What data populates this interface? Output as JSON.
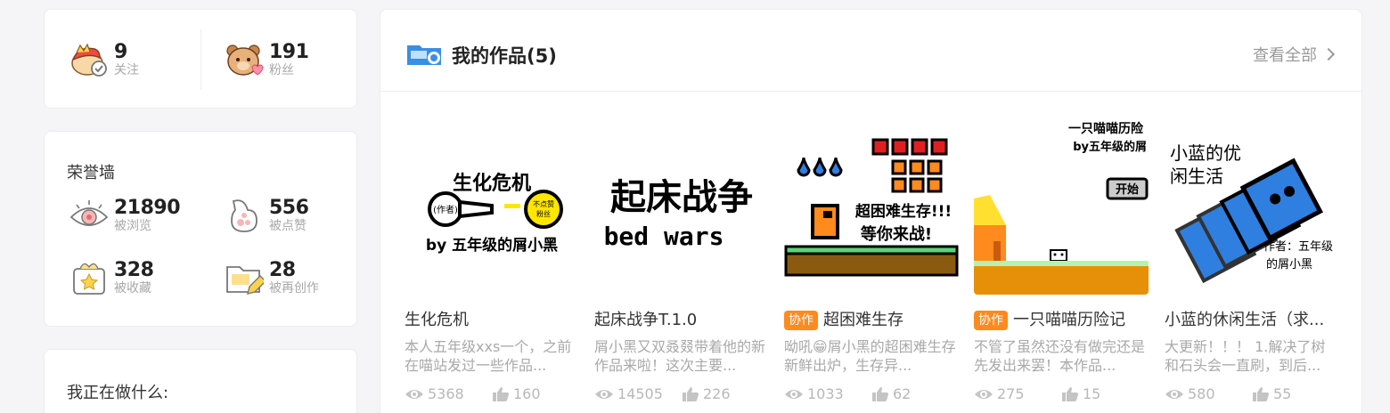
{
  "follow": {
    "following": {
      "count": "9",
      "label": "关注"
    },
    "fans": {
      "count": "191",
      "label": "粉丝"
    }
  },
  "honor": {
    "title": "荣誉墙",
    "items": [
      {
        "count": "21890",
        "label": "被浏览"
      },
      {
        "count": "556",
        "label": "被点赞"
      },
      {
        "count": "328",
        "label": "被收藏"
      },
      {
        "count": "28",
        "label": "被再创作"
      }
    ]
  },
  "doing": {
    "title": "我正在做什么:"
  },
  "works": {
    "title": "我的作品(5)",
    "view_all": "查看全部",
    "items": [
      {
        "title": "生化危机",
        "tag": "",
        "desc": "本人五年级xxs一个，之前在喵站发过一些作品...",
        "views": "5368",
        "likes": "160",
        "thumb": {
          "line1": "生化危机",
          "author_label": "(作者)",
          "badge": "不点赞 粉丝",
          "byline": "by 五年级的屑小黑"
        }
      },
      {
        "title": "起床战争T.1.0",
        "tag": "",
        "desc": "屑小黑又双叒叕带着他的新作品来啦！这次主要...",
        "views": "14505",
        "likes": "226",
        "thumb": {
          "line1": "起床战争",
          "line2": "bed wars"
        }
      },
      {
        "title": "超困难生存",
        "tag": "协作",
        "desc": "呦吼😁屑小黑的超困难生存新鲜出炉，生存异...",
        "views": "1033",
        "likes": "62",
        "thumb": {
          "line1": "超困难生存!!!",
          "line2": "等你来战!"
        }
      },
      {
        "title": "一只喵喵历险记",
        "tag": "协作",
        "desc": "不管了虽然还没有做完还是先发出来罢！本作品...",
        "views": "275",
        "likes": "15",
        "thumb": {
          "line1": "一只喵喵历险",
          "line2": "by五年级的屑",
          "button": "开始"
        }
      },
      {
        "title": "小蓝的休闲生活（求...",
        "tag": "",
        "desc": "大更新！！！ 1.解决了树和石头会一直刷，到后...",
        "views": "580",
        "likes": "55",
        "thumb": {
          "line1": "小蓝的优",
          "line2": "闲生活",
          "author": "作者：五年级",
          "author2": "的屑小黑"
        }
      }
    ]
  },
  "colors": {
    "accent_orange": "#ff8a1d",
    "blue": "#2f7fe0",
    "icon_blue": "#3a8ee6"
  }
}
